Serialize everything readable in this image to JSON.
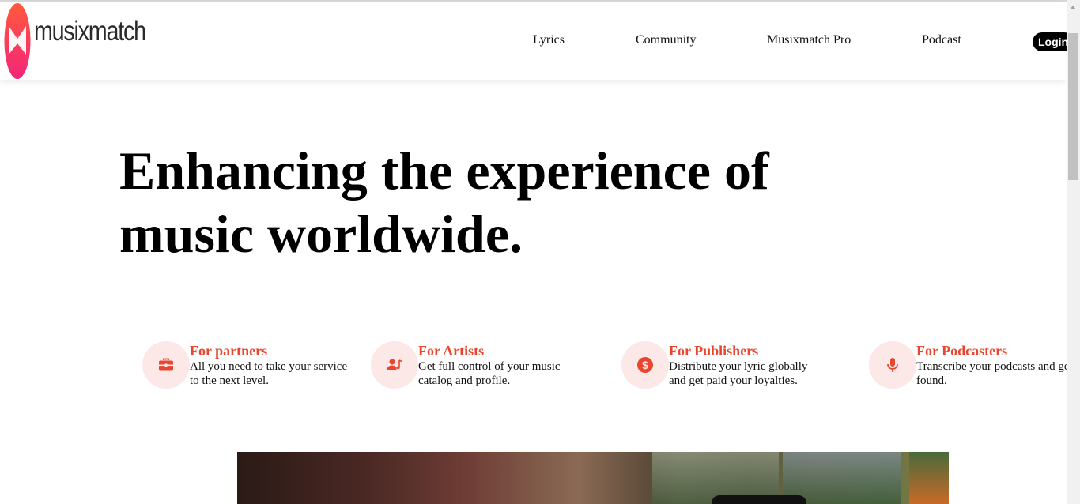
{
  "header": {
    "logo_text": "musixmatch",
    "nav": [
      "Lyrics",
      "Community",
      "Musixmatch Pro",
      "Podcast"
    ],
    "login_label": "Login"
  },
  "hero": {
    "line1": "Enhancing the experience of",
    "line2": "music worldwide."
  },
  "features": [
    {
      "title": "For partners",
      "desc": "All you need to take your service to the next level.",
      "icon": "briefcase-icon"
    },
    {
      "title": "For Artists",
      "desc": "Get full control of your music catalog and profile.",
      "icon": "artist-icon"
    },
    {
      "title": "For Publishers",
      "desc": "Distribute your lyric globally and get paid your loyalties.",
      "icon": "dollar-icon"
    },
    {
      "title": "For Podcasters",
      "desc": "Transcribe your podcasts and get found.",
      "icon": "microphone-icon"
    }
  ],
  "colors": {
    "accent": "#e8462e",
    "icon_bg": "#fde8e8",
    "login_bg": "#000000"
  }
}
